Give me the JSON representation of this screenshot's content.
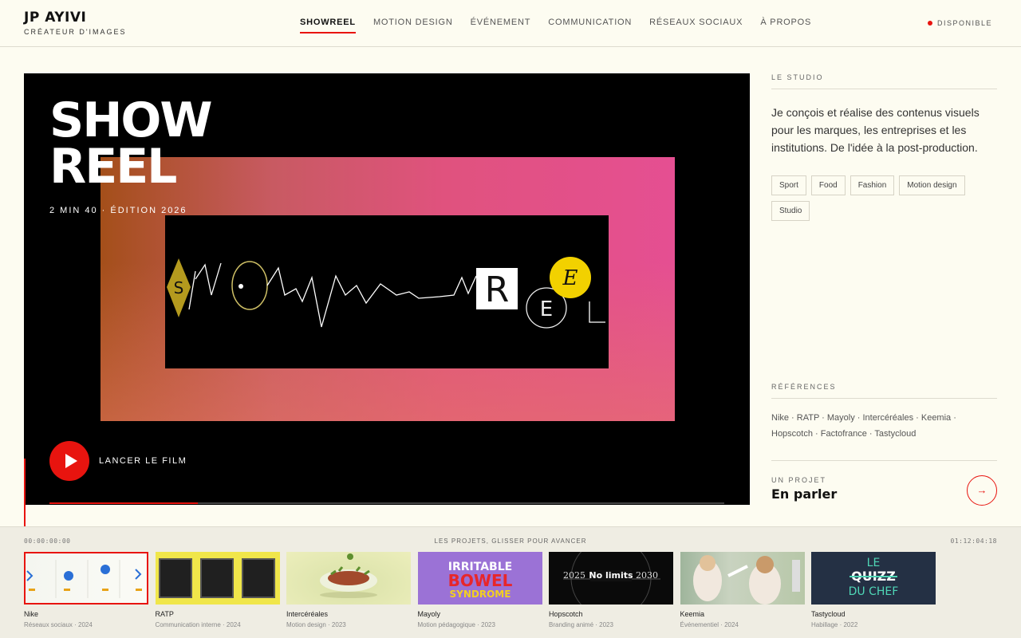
{
  "brand": {
    "name": "JP AYIVI",
    "tagline": "CRÉATEUR D'IMAGES"
  },
  "nav": {
    "items": [
      {
        "label": "SHOWREEL",
        "active": true
      },
      {
        "label": "MOTION DESIGN"
      },
      {
        "label": "ÉVÉNEMENT"
      },
      {
        "label": "COMMUNICATION"
      },
      {
        "label": "RÉSEAUX SOCIAUX"
      },
      {
        "label": "À PROPOS"
      }
    ]
  },
  "status": {
    "label": "DISPONIBLE",
    "color": "#e8140f"
  },
  "video": {
    "title_line1": "SHOW",
    "title_line2": "REEL",
    "meta": "2 MIN 40 · ÉDITION 2026",
    "play_label": "LANCER LE FILM",
    "progress": 0.22,
    "scribble_letters": [
      "S",
      "R",
      "E",
      "E"
    ]
  },
  "sidebar": {
    "studio_heading": "LE STUDIO",
    "studio_text": "Je conçois et réalise des contenus visuels pour les marques, les entreprises et les institutions. De l'idée à la post-production.",
    "tags": [
      "Sport",
      "Food",
      "Fashion",
      "Motion design",
      "Studio"
    ],
    "references_heading": "RÉFÉRENCES",
    "references": "Nike · RATP · Mayoly · Intercéréales · Keemia · Hopscotch · Factofrance · Tastycloud",
    "cta_kicker": "UN PROJET",
    "cta_title": "En parler",
    "cta_icon": "arrow-right-icon"
  },
  "timeline": {
    "start": "00:00:00:00",
    "end": "01:12:04:18",
    "hint": "LES PROJETS, GLISSER POUR AVANCER",
    "clips": [
      {
        "name": "Nike",
        "meta": "Réseaux sociaux · 2024",
        "active": true
      },
      {
        "name": "RATP",
        "meta": "Communication interne · 2024"
      },
      {
        "name": "Intercéréales",
        "meta": "Motion design · 2023"
      },
      {
        "name": "Mayoly",
        "meta": "Motion pédagogique · 2023",
        "thumb_text": [
          "IRRITABLE",
          "BOWEL",
          "SYNDROME"
        ]
      },
      {
        "name": "Hopscotch",
        "meta": "Branding animé · 2023",
        "thumb_text": [
          "2025",
          "No limits",
          "2030"
        ]
      },
      {
        "name": "Keemia",
        "meta": "Événementiel · 2024"
      },
      {
        "name": "Tastycloud",
        "meta": "Habillage · 2022",
        "thumb_text": [
          "LE",
          "QUIZZ",
          "DU CHEF"
        ]
      }
    ]
  },
  "colors": {
    "accent": "#e8140f",
    "background": "#fdfcf1",
    "timeline_bg": "#efede3"
  }
}
